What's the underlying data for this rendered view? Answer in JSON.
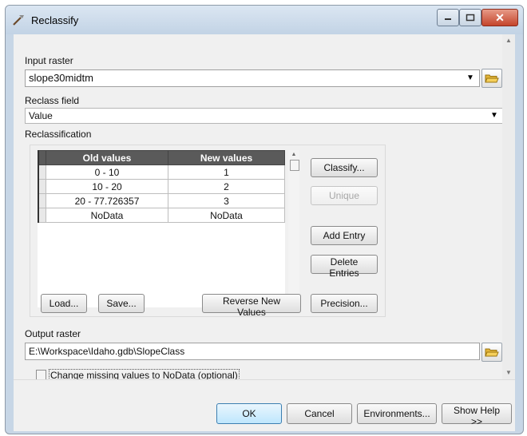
{
  "window": {
    "title": "Reclassify"
  },
  "input_raster": {
    "label": "Input raster",
    "value": "slope30midtm"
  },
  "reclass_field": {
    "label": "Reclass field",
    "value": "Value"
  },
  "reclassification": {
    "label": "Reclassification",
    "columns": [
      "Old values",
      "New values"
    ],
    "rows": [
      {
        "old": "0 - 10",
        "new": "1"
      },
      {
        "old": "10 - 20",
        "new": "2"
      },
      {
        "old": "20 - 77.726357",
        "new": "3"
      },
      {
        "old": "NoData",
        "new": "NoData"
      }
    ],
    "buttons": {
      "classify": "Classify...",
      "unique": "Unique",
      "add_entry": "Add Entry",
      "delete_entries": "Delete Entries",
      "load": "Load...",
      "save": "Save...",
      "reverse": "Reverse New Values",
      "precision": "Precision..."
    }
  },
  "output_raster": {
    "label": "Output raster",
    "value": "E:\\Workspace\\Idaho.gdb\\SlopeClass"
  },
  "missing_nodata": {
    "label": "Change missing values to NoData (optional)",
    "checked": false
  },
  "footer": {
    "ok": "OK",
    "cancel": "Cancel",
    "environments": "Environments...",
    "help": "Show Help >>"
  },
  "icons": [
    "reclassify-tool-icon",
    "minimize-icon",
    "maximize-icon",
    "close-icon",
    "folder-open-icon",
    "dropdown-arrow-icon"
  ]
}
